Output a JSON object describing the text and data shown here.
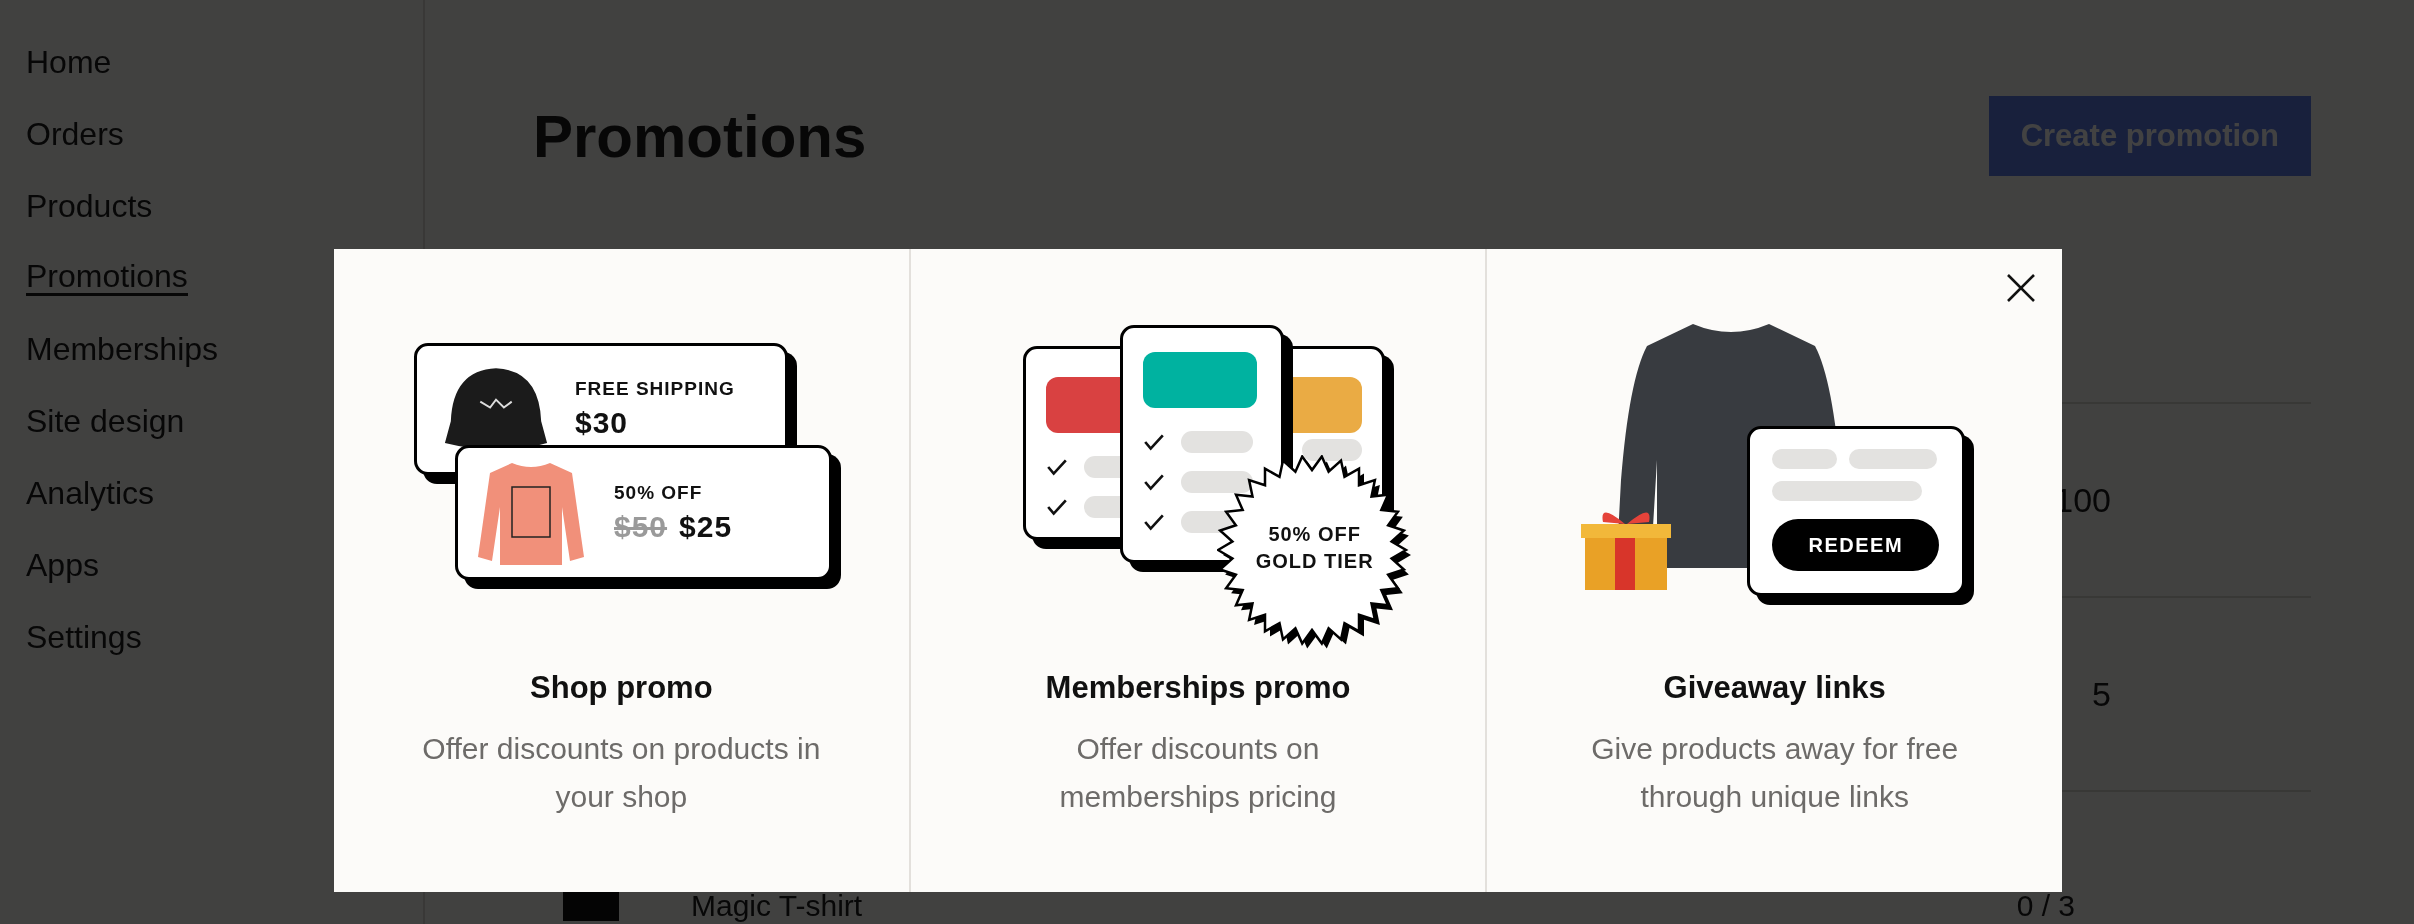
{
  "sidebar": {
    "items": [
      {
        "label": "Home",
        "selected": false
      },
      {
        "label": "Orders",
        "selected": false
      },
      {
        "label": "Products",
        "selected": false
      },
      {
        "label": "Promotions",
        "selected": true
      },
      {
        "label": "Memberships",
        "selected": false
      },
      {
        "label": "Site design",
        "selected": false
      },
      {
        "label": "Analytics",
        "selected": false
      },
      {
        "label": "Apps",
        "selected": false
      },
      {
        "label": "Settings",
        "selected": false
      }
    ]
  },
  "page": {
    "title": "Promotions",
    "create_button": "Create promotion"
  },
  "table": {
    "rows": [
      {
        "value": "100"
      },
      {
        "value": "5"
      },
      {
        "name": "Magic T-shirt",
        "value": "0 / 3"
      }
    ]
  },
  "modal": {
    "options": [
      {
        "kind": "shop",
        "title": "Shop promo",
        "description_lines": [
          "Offer discounts on products in",
          "your shop"
        ],
        "card_1_label": "FREE SHIPPING",
        "card_1_price": "$30",
        "card_2_label": "50% OFF",
        "card_2_old_price": "$50",
        "card_2_price": "$25"
      },
      {
        "kind": "memberships",
        "title": "Memberships promo",
        "description_lines": [
          "Offer discounts on",
          "memberships pricing"
        ],
        "badge_lines": [
          "50% OFF",
          "GOLD TIER"
        ]
      },
      {
        "kind": "giveaway",
        "title": "Giveaway links",
        "description_lines": [
          "Give products away for free",
          "through unique links"
        ],
        "button": "REDEEM"
      }
    ]
  }
}
